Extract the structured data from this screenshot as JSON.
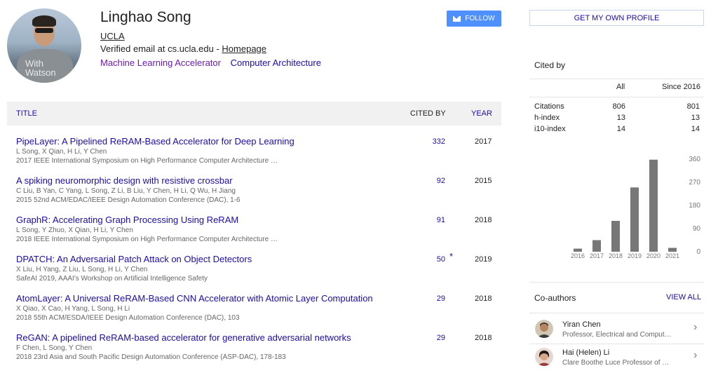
{
  "profile": {
    "name": "Linghao Song",
    "affiliation": "UCLA",
    "verified_prefix": "Verified email at cs.ucla.edu - ",
    "homepage": "Homepage",
    "interests": [
      "Machine Learning Accelerator",
      "Computer Architecture"
    ],
    "follow_label": "FOLLOW",
    "avatar_shirt_text_1": "With",
    "avatar_shirt_text_2": "Watson"
  },
  "table": {
    "header_title": "TITLE",
    "header_cited": "CITED BY",
    "header_year": "YEAR",
    "rows": [
      {
        "title": "PipeLayer: A Pipelined ReRAM-Based Accelerator for Deep Learning",
        "authors": "L Song, X Qian, H Li, Y Chen",
        "venue": "2017 IEEE International Symposium on High Performance Computer Architecture …",
        "cited": "332",
        "year": "2017",
        "star": ""
      },
      {
        "title": "A spiking neuromorphic design with resistive crossbar",
        "authors": "C Liu, B Yan, C Yang, L Song, Z Li, B Liu, Y Chen, H Li, Q Wu, H Jiang",
        "venue": "2015 52nd ACM/EDAC/IEEE Design Automation Conference (DAC), 1-6",
        "cited": "92",
        "year": "2015",
        "star": ""
      },
      {
        "title": "GraphR: Accelerating Graph Processing Using ReRAM",
        "authors": "L Song, Y Zhuo, X Qian, H Li, Y Chen",
        "venue": "2018 IEEE International Symposium on High Performance Computer Architecture …",
        "cited": "91",
        "year": "2018",
        "star": ""
      },
      {
        "title": "DPATCH: An Adversarial Patch Attack on Object Detectors",
        "authors": "X Liu, H Yang, Z Liu, L Song, H Li, Y Chen",
        "venue": "SafeAI 2019, AAAI's Workshop on Artificial Intelligence Safety",
        "cited": "50",
        "year": "2019",
        "star": "*"
      },
      {
        "title": "AtomLayer: A Universal ReRAM-Based CNN Accelerator with Atomic Layer Computation",
        "authors": "X Qiao, X Cao, H Yang, L Song, H Li",
        "venue": "2018 55th ACM/ESDA/IEEE Design Automation Conference (DAC), 103",
        "cited": "29",
        "year": "2018",
        "star": ""
      },
      {
        "title": "ReGAN: A pipelined ReRAM-based accelerator for generative adversarial networks",
        "authors": "F Chen, L Song, Y Chen",
        "venue": "2018 23rd Asia and South Pacific Design Automation Conference (ASP-DAC), 178-183",
        "cited": "29",
        "year": "2018",
        "star": ""
      }
    ]
  },
  "sidebar": {
    "own_profile_label": "GET MY OWN PROFILE",
    "cited_by_label": "Cited by",
    "col_all": "All",
    "col_since": "Since 2016",
    "stats": [
      {
        "label": "Citations",
        "all": "806",
        "since": "801"
      },
      {
        "label": "h-index",
        "all": "13",
        "since": "13"
      },
      {
        "label": "i10-index",
        "all": "14",
        "since": "14"
      }
    ],
    "coauthors_label": "Co-authors",
    "view_all_label": "VIEW ALL",
    "coauthors": [
      {
        "name": "Yiran Chen",
        "affiliation": "Professor, Electrical and Comput…"
      },
      {
        "name": "Hai (Helen) Li",
        "affiliation": "Clare Boothe Luce Professor of …"
      }
    ]
  },
  "chart_data": {
    "type": "bar",
    "categories": [
      "2016",
      "2017",
      "2018",
      "2019",
      "2020",
      "2021"
    ],
    "values": [
      12,
      45,
      120,
      250,
      358,
      15
    ],
    "y_ticks": [
      "0",
      "90",
      "180",
      "270",
      "360"
    ],
    "ylim": [
      0,
      360
    ],
    "grid": false,
    "bar_color": "#777777"
  }
}
